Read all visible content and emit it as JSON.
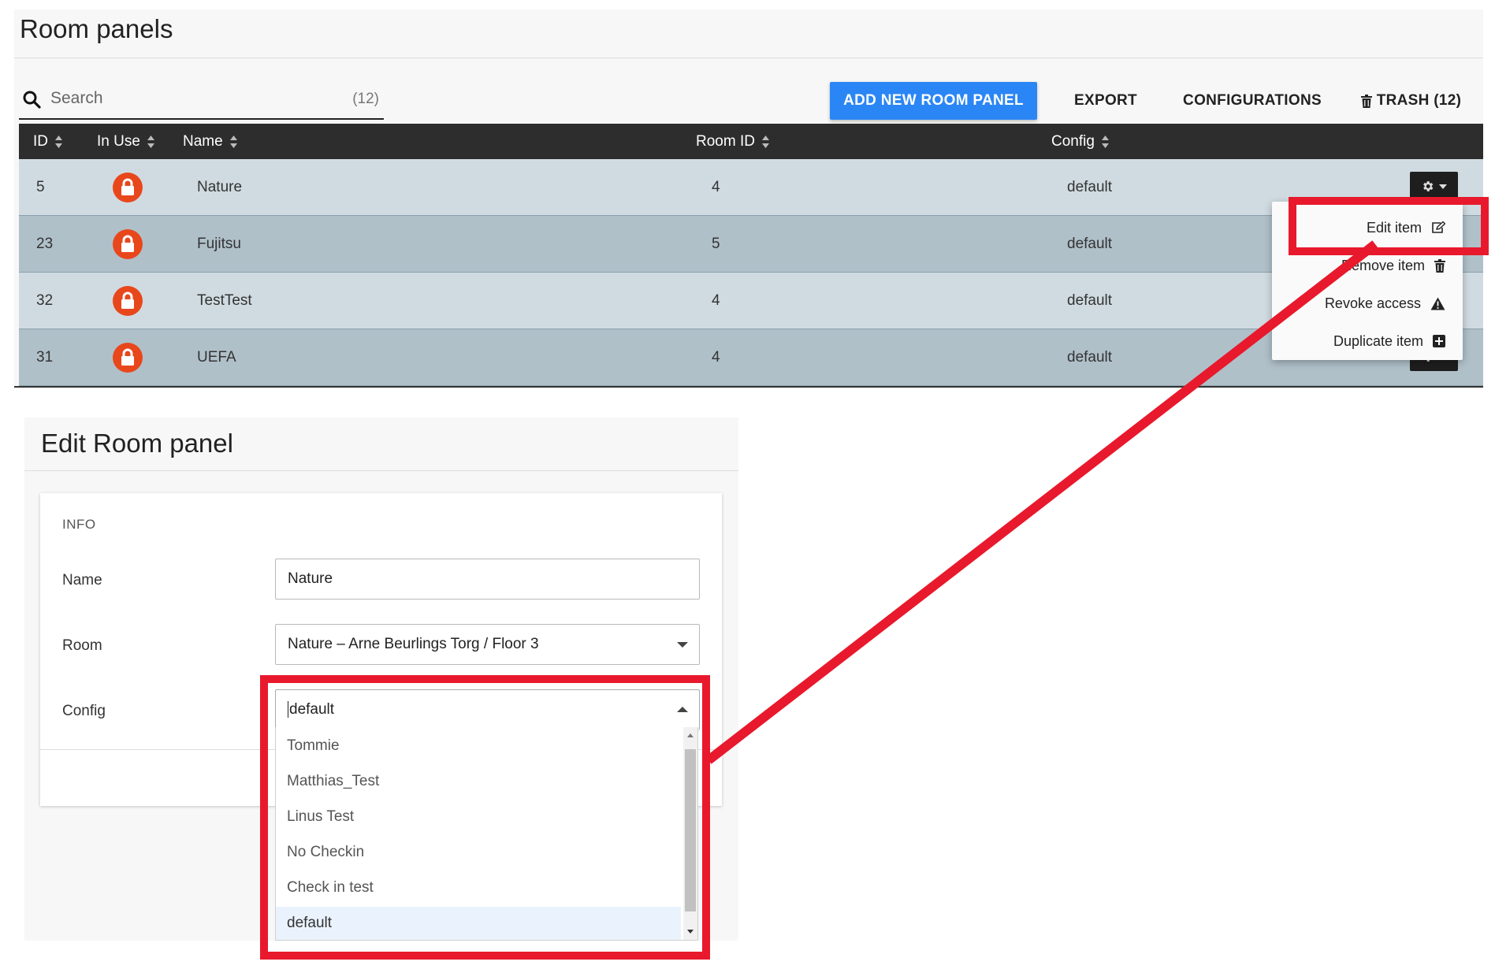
{
  "page": {
    "title": "Room panels"
  },
  "search": {
    "placeholder": "Search",
    "count": "(12)"
  },
  "toolbar": {
    "add_label": "ADD NEW ROOM PANEL",
    "export_label": "EXPORT",
    "configurations_label": "CONFIGURATIONS",
    "trash_label": "TRASH (12)"
  },
  "table": {
    "columns": [
      "ID",
      "In Use",
      "Name",
      "Room ID",
      "Config"
    ],
    "rows": [
      {
        "id": "5",
        "name": "Nature",
        "room_id": "4",
        "config": "default",
        "in_use_icon": "lock-icon"
      },
      {
        "id": "23",
        "name": "Fujitsu",
        "room_id": "5",
        "config": "default",
        "in_use_icon": "lock-icon"
      },
      {
        "id": "32",
        "name": "TestTest",
        "room_id": "4",
        "config": "default",
        "in_use_icon": "lock-icon"
      },
      {
        "id": "31",
        "name": "UEFA",
        "room_id": "4",
        "config": "default",
        "in_use_icon": "lock-icon"
      }
    ]
  },
  "row_menu": {
    "items": [
      {
        "label": "Edit item",
        "icon": "edit-icon"
      },
      {
        "label": "Remove item",
        "icon": "trash-icon"
      },
      {
        "label": "Revoke access",
        "icon": "warning-icon"
      },
      {
        "label": "Duplicate item",
        "icon": "plus-square-icon"
      }
    ]
  },
  "edit": {
    "title": "Edit Room panel",
    "section": "INFO",
    "name_label": "Name",
    "name_value": "Nature",
    "room_label": "Room",
    "room_value": "Nature – Arne Beurlings Torg / Floor 3",
    "config_label": "Config",
    "config_value": "default",
    "config_options": [
      "Tommie",
      "Matthias_Test",
      "Linus Test",
      "No Checkin",
      "Check in test",
      "default"
    ]
  },
  "colors": {
    "primary": "#2b86f5",
    "header_bg": "#2d2d2d",
    "row_light": "#d0dbe1",
    "row_dark": "#b0c0c9",
    "lock": "#e8471c",
    "annotation": "#e8192c"
  }
}
